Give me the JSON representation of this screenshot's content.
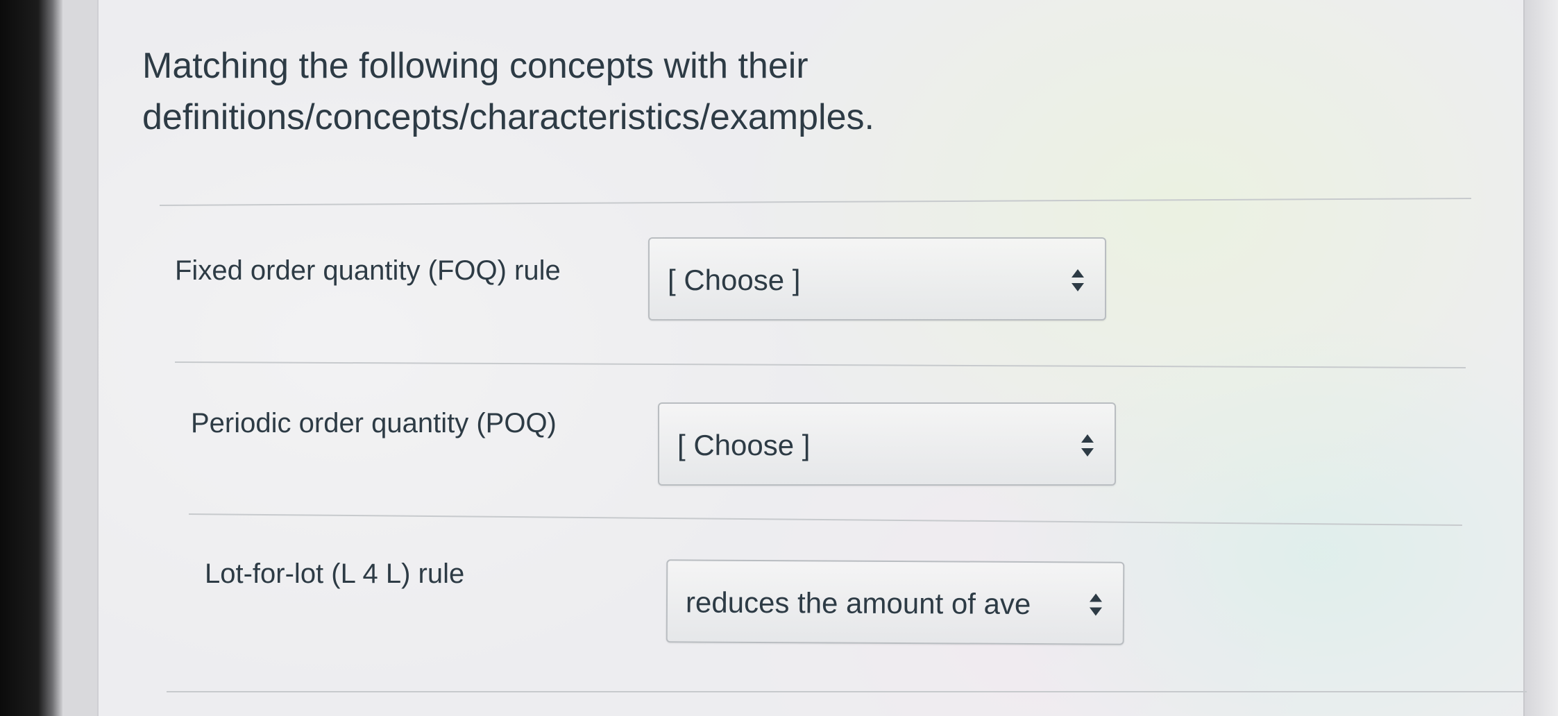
{
  "question": {
    "line1": "Matching the following concepts with their",
    "line2": "definitions/concepts/characteristics/examples."
  },
  "matches": [
    {
      "term": "Fixed order quantity (FOQ) rule",
      "selected": "[ Choose ]"
    },
    {
      "term": "Periodic order quantity (POQ)",
      "selected": "[ Choose ]"
    },
    {
      "term": "Lot-for-lot (L 4 L) rule",
      "selected": "reduces the amount of ave"
    }
  ],
  "icons": {
    "dropdown": "up-down-arrows-icon"
  },
  "colors": {
    "text": "#2d3b45",
    "border": "#b9bdc1",
    "divider": "#c7cacd"
  }
}
